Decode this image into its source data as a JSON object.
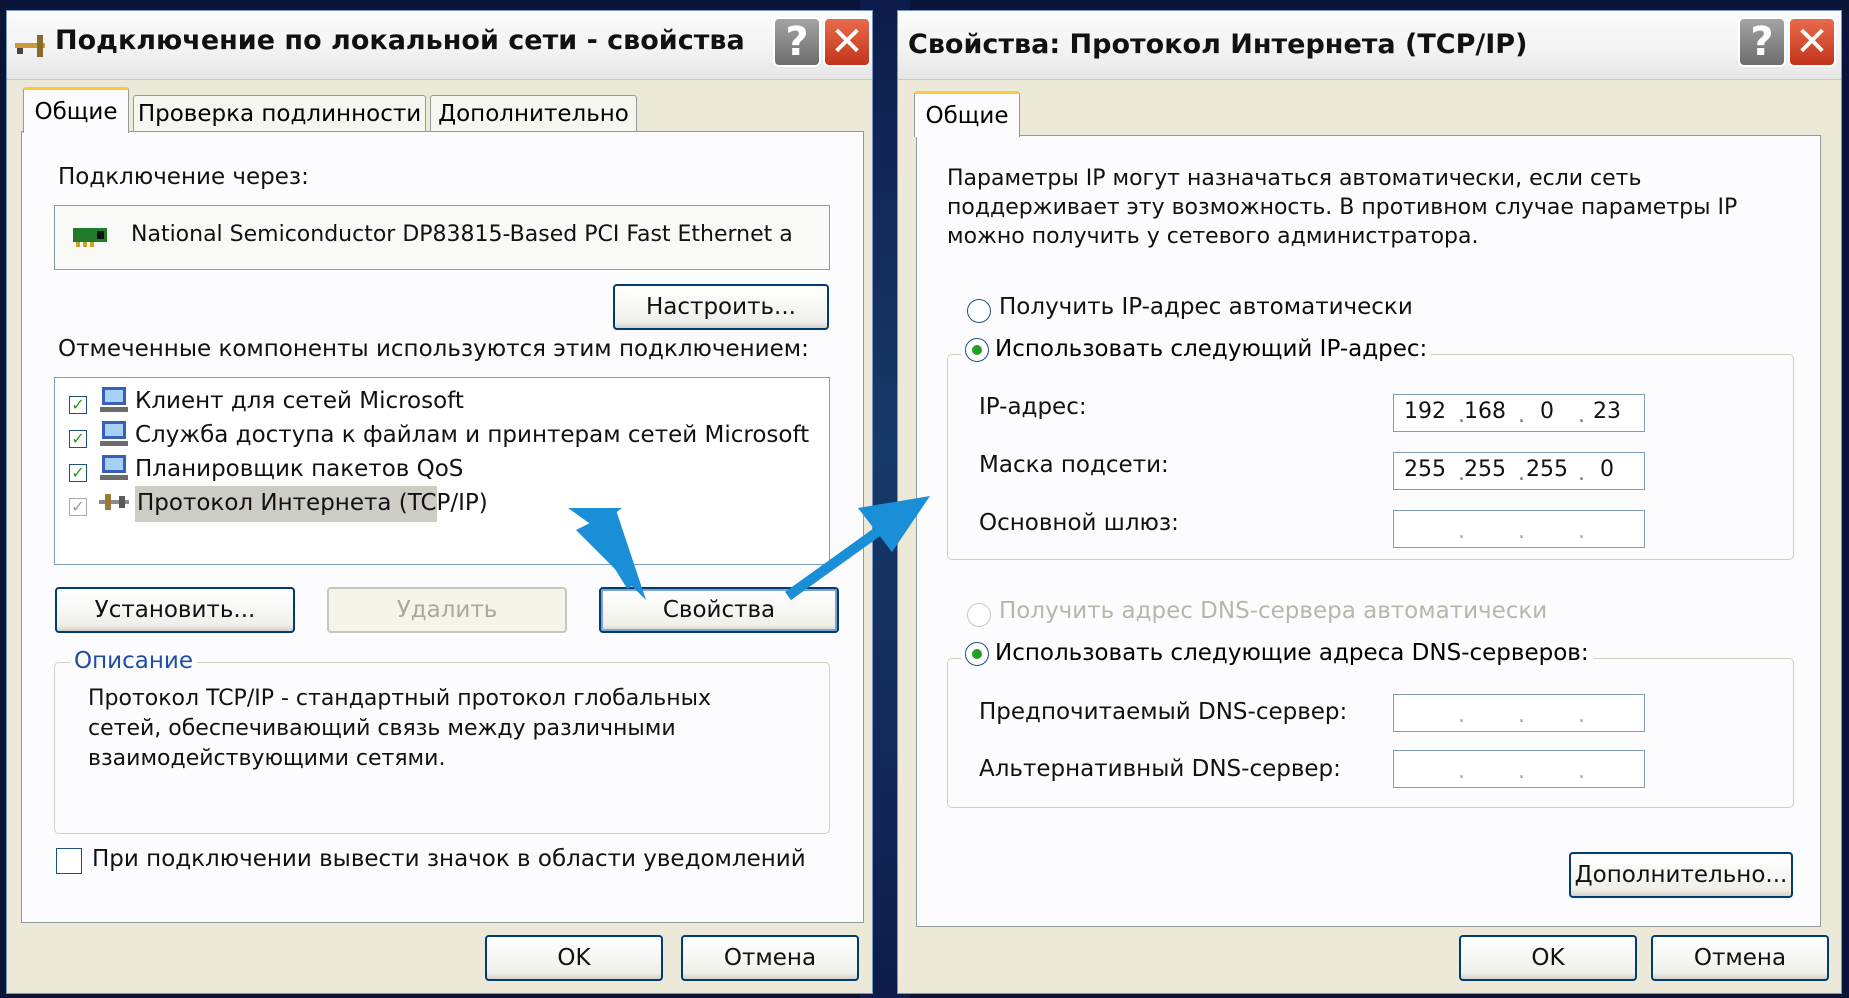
{
  "left": {
    "title": "Подключение по локальной сети - свойства",
    "tabs": [
      "Общие",
      "Проверка подлинности",
      "Дополнительно"
    ],
    "connect_via_label": "Подключение через:",
    "adapter": "National Semiconductor DP83815-Based PCI Fast Ethernet a",
    "configure_button": "Настроить...",
    "components_label": "Отмеченные компоненты используются этим подключением:",
    "components": [
      {
        "label": "Клиент для сетей Microsoft",
        "checked": true
      },
      {
        "label": "Служба доступа к файлам и принтерам сетей Microsoft",
        "checked": true
      },
      {
        "label": "Планировщик пакетов QoS",
        "checked": true
      },
      {
        "label": "Протокол Интернета (TCP/IP)",
        "checked": true,
        "selected": true
      }
    ],
    "install_button": "Установить...",
    "remove_button": "Удалить",
    "properties_button": "Свойства",
    "description_legend": "Описание",
    "description_lines": [
      "Протокол TCP/IP - стандартный протокол глобальных",
      "сетей, обеспечивающий связь между различными",
      "взаимодействующими сетями."
    ],
    "notify_checkbox": "При подключении вывести значок в области уведомлений",
    "ok_button": "OK",
    "cancel_button": "Отмена"
  },
  "right": {
    "title": "Свойства: Протокол Интернета (TCP/IP)",
    "tabs": [
      "Общие"
    ],
    "intro_lines": [
      "Параметры IP могут назначаться автоматически, если сеть",
      "поддерживает эту возможность. В противном случае параметры IP",
      "можно получить у сетевого администратора."
    ],
    "radio_ip_auto": "Получить IP-адрес автоматически",
    "radio_ip_manual": "Использовать следующий IP-адрес:",
    "ip_label": "IP-адрес:",
    "ip_value": [
      "192",
      "168",
      "0",
      "23"
    ],
    "mask_label": "Маска подсети:",
    "mask_value": [
      "255",
      "255",
      "255",
      "0"
    ],
    "gateway_label": "Основной шлюз:",
    "radio_dns_auto": "Получить адрес DNS-сервера автоматически",
    "radio_dns_manual": "Использовать следующие адреса DNS-серверов:",
    "dns_preferred_label": "Предпочитаемый DNS-сервер:",
    "dns_alternate_label": "Альтернативный DNS-сервер:",
    "advanced_button": "Дополнительно...",
    "ok_button": "OK",
    "cancel_button": "Отмена"
  },
  "colors": {
    "background": "#0a1438",
    "arrow": "#1a8fd8",
    "window_face": "#ece9d8",
    "radio_dot": "#21a121",
    "close_button": "#c2351a"
  }
}
